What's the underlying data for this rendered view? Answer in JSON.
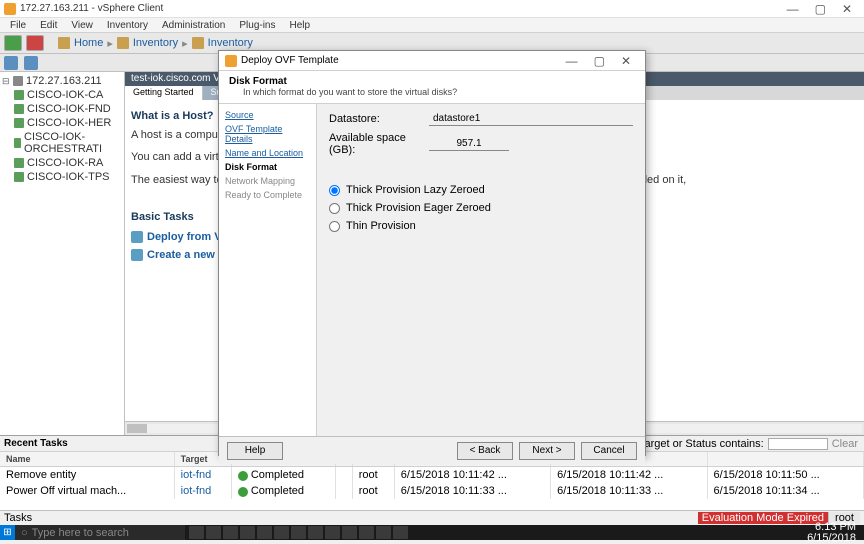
{
  "titlebar": {
    "title": "172.27.163.211 - vSphere Client"
  },
  "menu": [
    "File",
    "Edit",
    "View",
    "Inventory",
    "Administration",
    "Plug-ins",
    "Help"
  ],
  "breadcrumb": {
    "home": "Home",
    "inv1": "Inventory",
    "inv2": "Inventory"
  },
  "tree": {
    "root": "172.27.163.211",
    "items": [
      "CISCO-IOK-CA",
      "CISCO-IOK-FND",
      "CISCO-IOK-HER",
      "CISCO-IOK-ORCHESTRATI",
      "CISCO-IOK-RA",
      "CISCO-IOK-TPS"
    ]
  },
  "content": {
    "header": "test-iok.cisco.com VMwar",
    "tabs": {
      "t1": "Getting Started",
      "t2": "Summary"
    },
    "h3": "What is a Host?",
    "p1": "A host is a computer tl as ESX or ESXi, to run CPU and memory resc give virtual machines a connectivity.",
    "p2": "You can add a virtual i one or by deploying a",
    "p3": "The easiest way to adc virtual appliance. A vir machine with an opera installed. A new virtual system installed on it,",
    "basic": "Basic Tasks",
    "task1": "Deploy from VA",
    "task2": "Create a new vi"
  },
  "recent": {
    "title": "Recent Tasks",
    "filter": "Name, Target or Status contains:",
    "clear": "Clear",
    "cols": [
      "Name",
      "Target",
      "Status",
      "",
      "",
      "",
      "",
      "",
      ""
    ],
    "rows": [
      {
        "name": "Remove entity",
        "target": "iot-fnd",
        "status": "Completed",
        "user": "root",
        "t1": "6/15/2018 10:11:42 ...",
        "t2": "6/15/2018 10:11:42 ...",
        "t3": "6/15/2018 10:11:50 ..."
      },
      {
        "name": "Power Off virtual mach...",
        "target": "iot-fnd",
        "status": "Completed",
        "user": "root",
        "t1": "6/15/2018 10:11:33 ...",
        "t2": "6/15/2018 10:11:33 ...",
        "t3": "6/15/2018 10:11:34 ..."
      }
    ]
  },
  "statusrow": {
    "tasks": "Tasks",
    "eval": "Evaluation Mode Expired",
    "root": "root"
  },
  "taskbar": {
    "search": "Type here to search",
    "time": "6:13 PM",
    "date": "6/15/2018"
  },
  "dialog": {
    "title": "Deploy OVF Template",
    "section": "Disk Format",
    "subtitle": "In which format do you want to store the virtual disks?",
    "steps": {
      "source": "Source",
      "ovf": "OVF Template Details",
      "name": "Name and Location",
      "disk": "Disk Format",
      "net": "Network Mapping",
      "ready": "Ready to Complete"
    },
    "datastore_label": "Datastore:",
    "datastore": "datastore1",
    "space_label": "Available space (GB):",
    "space": "957.1",
    "r1": "Thick Provision Lazy Zeroed",
    "r2": "Thick Provision Eager Zeroed",
    "r3": "Thin Provision",
    "help": "Help",
    "back": "< Back",
    "next": "Next >",
    "cancel": "Cancel"
  }
}
